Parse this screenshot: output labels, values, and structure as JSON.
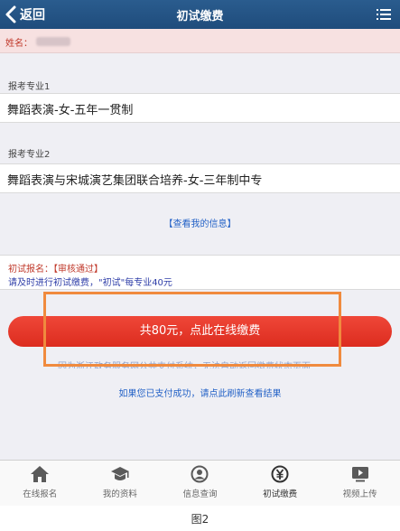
{
  "header": {
    "back_label": "返回",
    "title": "初试缴费"
  },
  "name_bar": {
    "label": "姓名："
  },
  "majors": [
    {
      "label": "报考专业1",
      "value": "舞蹈表演-女-五年一贯制"
    },
    {
      "label": "报考专业2",
      "value": "舞蹈表演与宋城演艺集团联合培养-女-三年制中专"
    }
  ],
  "info_link": "【查看我的信息】",
  "status": {
    "line1": "初试报名：【审核通过】",
    "line2": "请及时进行初试缴费，\"初试\"每专业40元"
  },
  "pay_button": "共80元，点此在线缴费",
  "faded_note": "因为浙江政务服务网公共支付系统，无法自动返回缴费状态页面",
  "refresh_link": "如果您已支付成功，请点此刷新查看结果",
  "tabs": [
    {
      "label": "在线报名",
      "icon": "home-icon"
    },
    {
      "label": "我的资料",
      "icon": "graduation-cap-icon"
    },
    {
      "label": "信息查询",
      "icon": "user-search-icon"
    },
    {
      "label": "初试缴费",
      "icon": "yuan-icon"
    },
    {
      "label": "视频上传",
      "icon": "video-icon"
    }
  ],
  "caption": "图2",
  "colors": {
    "header": "#1f4c7c",
    "pay_button": "#e23b2c",
    "highlight_border": "#f08a3e",
    "link": "#2563c7"
  }
}
